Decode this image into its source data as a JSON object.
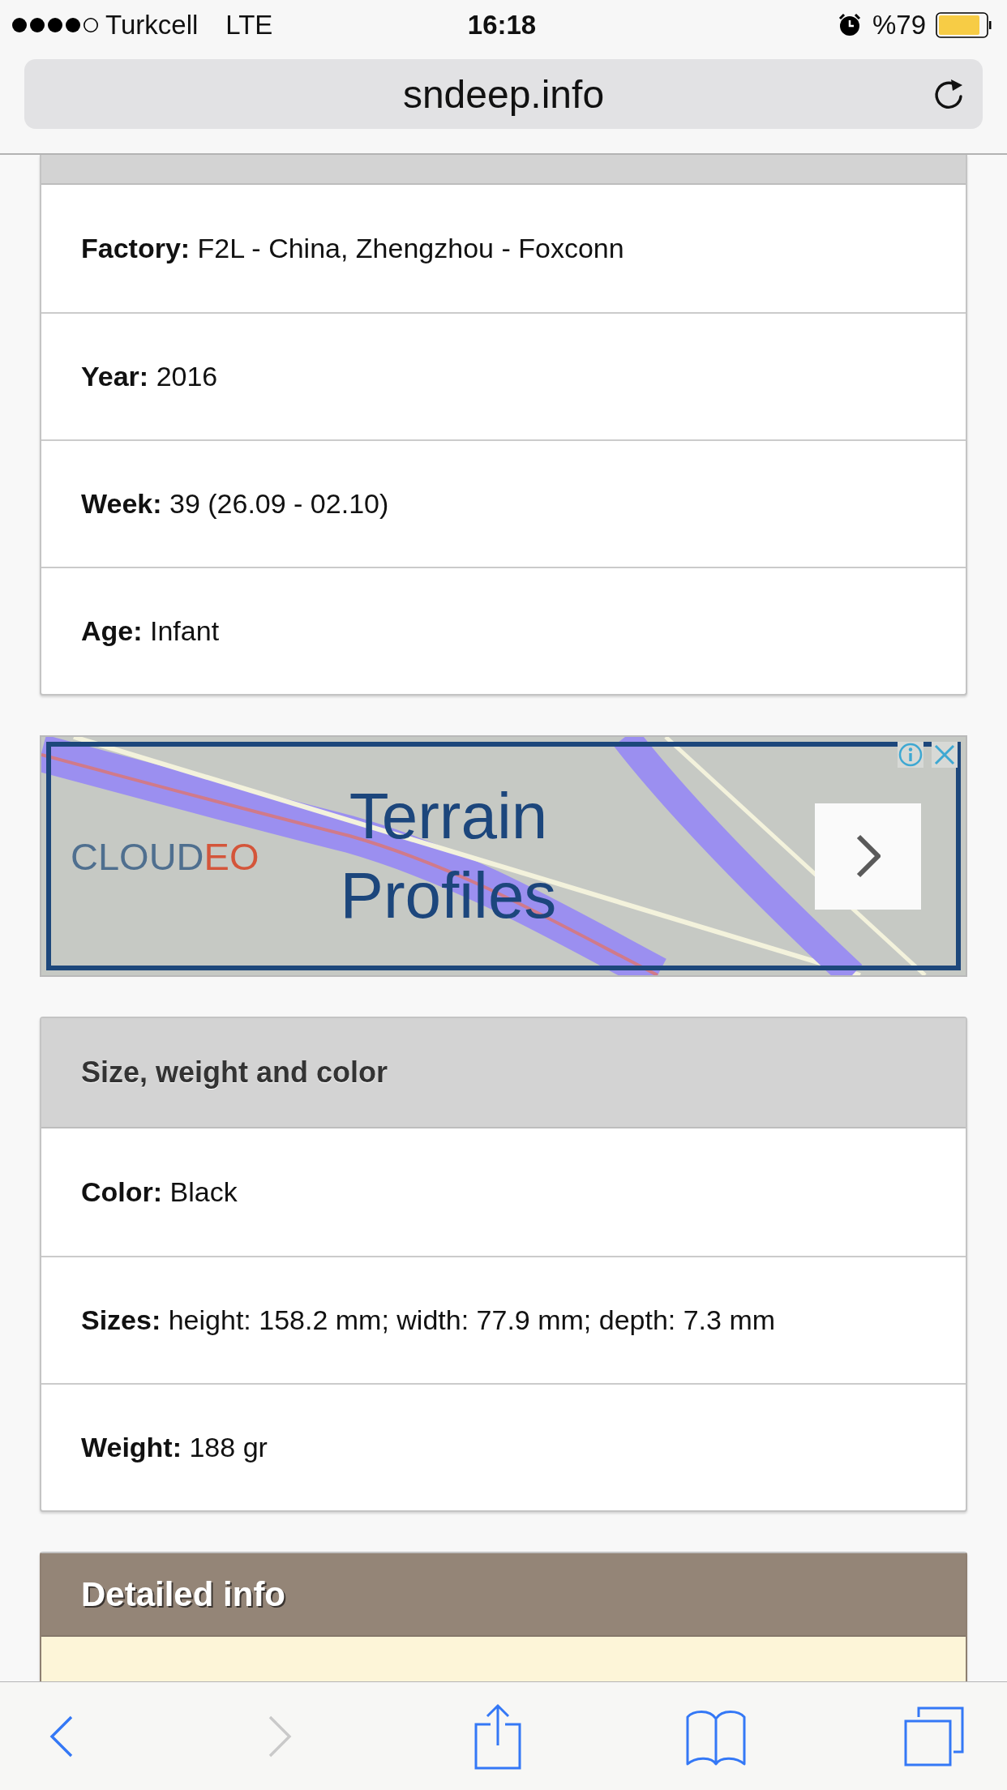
{
  "status_bar": {
    "carrier": "Turkcell",
    "network": "LTE",
    "time": "16:18",
    "battery": "%79"
  },
  "address_bar": {
    "url": "sndeep.info"
  },
  "blocks": [
    {
      "kind": "card",
      "rows": [
        "**Factory:** F2L - China, Zhengzhou - Foxconn",
        "**Year:** 2016",
        "**Week:** 39 (26.09 - 02.10)",
        "**Age:** Infant"
      ]
    },
    {
      "kind": "ad",
      "logo": [
        {
          "text": "CLOUD",
          "color": "#4f6f8f"
        },
        {
          "text": "EO",
          "color": "#d4553a"
        }
      ],
      "headline": "Terrain Profiles"
    },
    {
      "kind": "card",
      "title": "Size, weight and color",
      "rows": [
        "**Color:** Black",
        "**Sizes:** height: 158.2 mm; width: 77.9 mm; depth: 7.3 mm",
        "**Weight:** 188 gr"
      ]
    },
    {
      "kind": "detail",
      "title": "Detailed info"
    }
  ],
  "toolbar": [
    {
      "kind": "back",
      "disabled": false
    },
    {
      "kind": "forward",
      "disabled": true
    },
    {
      "kind": "share",
      "disabled": false
    },
    {
      "kind": "bookmarks",
      "disabled": false
    },
    {
      "kind": "tabs",
      "disabled": false
    }
  ]
}
